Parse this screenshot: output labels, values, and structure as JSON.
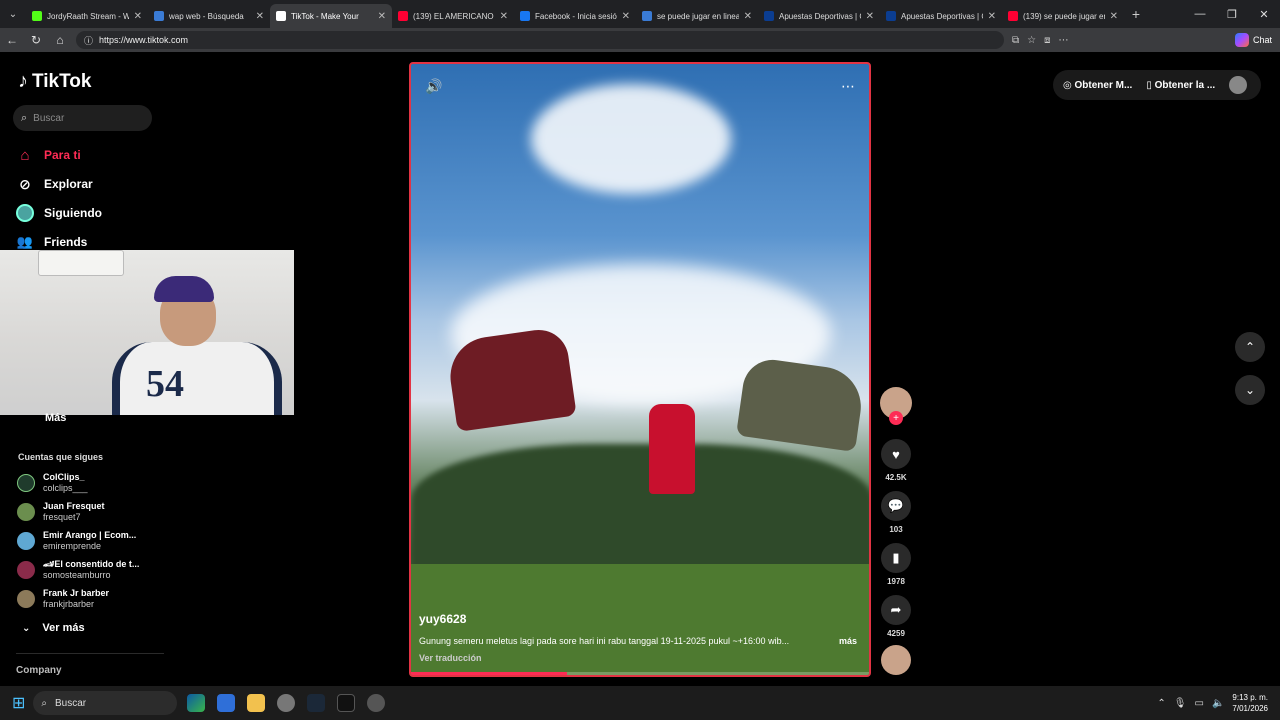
{
  "browser": {
    "tabs": [
      {
        "title": "JordyRaath Stream - Wa",
        "color": "#53fc18"
      },
      {
        "title": "wap web - Búsqueda",
        "color": "#3a7bd5"
      },
      {
        "title": "TikTok - Make Your",
        "color": "#ffffff"
      },
      {
        "title": "(139) EL AMERICANO 4!",
        "color": "#ff0033"
      },
      {
        "title": "Facebook - Inicia sesión",
        "color": "#1877f2"
      },
      {
        "title": "se puede jugar en linea",
        "color": "#3a7bd5"
      },
      {
        "title": "Apuestas Deportivas | C",
        "color": "#0b3d91"
      },
      {
        "title": "Apuestas Deportivas | C",
        "color": "#0b3d91"
      },
      {
        "title": "(139) se puede jugar en",
        "color": "#ff0033"
      }
    ],
    "url": "https://www.tiktok.com",
    "chat_label": "Chat"
  },
  "sidebar": {
    "logo": "TikTok",
    "search_placeholder": "Buscar",
    "nav": [
      {
        "label": "Para ti",
        "color": "#fe2c55"
      },
      {
        "label": "Explorar",
        "color": "#ffffff"
      },
      {
        "label": "Siguiendo",
        "color": "#ffffff"
      },
      {
        "label": "Friends",
        "color": "#ffffff"
      }
    ],
    "more_label": "Más",
    "following_heading": "Cuentas que sigues",
    "accounts": [
      {
        "name": "ColClips_",
        "user": "colclips___",
        "color": "#1f3b2c"
      },
      {
        "name": "Juan Fresquet",
        "user": "fresquet7",
        "color": "#6b8e4e"
      },
      {
        "name": "Emir Arango | Ecom...",
        "user": "emiremprende",
        "color": "#5fa8d3"
      },
      {
        "name": "🏎El consentido de t...",
        "user": "somosteamburro",
        "color": "#8a2b4a"
      },
      {
        "name": "Frank Jr barber",
        "user": "frankjrbarber",
        "color": "#8c7a5a"
      }
    ],
    "see_more": "Ver más",
    "company": "Company"
  },
  "video": {
    "username": "yuy6628",
    "caption": "Gunung semeru meletus lagi pada sore hari ini rabu tanggal 19-11-2025 pukul ~+16:00 wib...",
    "more": "más",
    "translate": "Ver traducción",
    "progress": 0.34
  },
  "actions": {
    "likes": "42.5K",
    "comments": "103",
    "saves": "1978",
    "shares": "4259"
  },
  "topbar": {
    "coins_label": "Obtener M...",
    "app_label": "Obtener la ..."
  },
  "taskbar": {
    "search_placeholder": "Buscar",
    "time": "9:13 p. m.",
    "date": "7/01/2026"
  }
}
